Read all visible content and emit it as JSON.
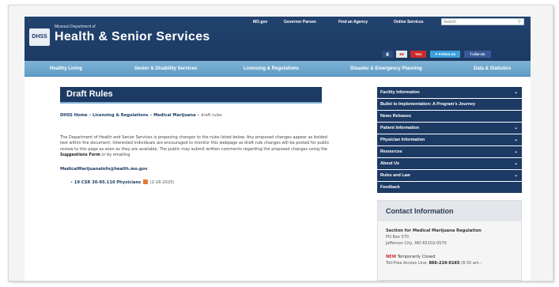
{
  "header": {
    "logo_text": "DHSS",
    "department": "Missouri Department of",
    "agency": "Health & Senior Services",
    "top_links": [
      "MO.gov",
      "Governor Parson",
      "Find an Agency",
      "Online Services"
    ],
    "search_placeholder": "Search",
    "social": [
      "print",
      "share",
      "YouTube",
      "Follow Us",
      "Like Us"
    ]
  },
  "nav": {
    "items": [
      "Healthy Living",
      "Senior & Disability Services",
      "Licensing & Regulations",
      "Disaster & Emergency Planning",
      "Data & Statistics"
    ]
  },
  "main": {
    "title": "Draft Rules",
    "breadcrumb": {
      "home": "DHSS Home",
      "sep1": " » ",
      "section": "Licensing & Regulations",
      "sep2": " » ",
      "sub": "Medical Marijuana",
      "sep3": " » ",
      "current": "draft rules"
    },
    "intro": {
      "text1": "The Department of Health and Senior Services is proposing changes to the rules listed below. Any proposed changes appear as bolded text within the document. Interested individuals are encouraged to monitor this webpage as draft rule changes will be posted for public review to this page as soon as they are available. The public may submit written comments regarding the proposed changes using the ",
      "form_link": "Suggestions Form",
      "text2": " or by emailing"
    },
    "email": "MedicalMarijuanaInfo@health.mo.gov",
    "rule": {
      "bullet": "•",
      "label": "19 CSR 30-95.110 Physicians",
      "date": "(2-18-2020)"
    }
  },
  "sidebar": {
    "items": [
      {
        "label": "Facility Information",
        "chevron": "⌄"
      },
      {
        "label": "Bullet to Implementation: A Program's Journey",
        "chevron": ""
      },
      {
        "label": "News Releases",
        "chevron": ""
      },
      {
        "label": "Patient Information",
        "chevron": "⌄"
      },
      {
        "label": "Physician Information",
        "chevron": "⌄"
      },
      {
        "label": "Resources",
        "chevron": "⌄"
      },
      {
        "label": "About Us",
        "chevron": "⌄"
      },
      {
        "label": "Rules and Law",
        "chevron": "⌄"
      },
      {
        "label": "Feedback",
        "chevron": ""
      }
    ]
  },
  "contact": {
    "heading": "Contact Information",
    "section": "Section for Medical Marijuana Regulation",
    "po_box": "PO Box 570",
    "city": "Jefferson City, MO 65102-0570",
    "status_new": "NEW",
    "status": "Temporarily Closed",
    "phone_label": "Toll-Free Access Line: ",
    "phone": "866-219-0165",
    "hours": " (8:30 am –"
  },
  "colors": {
    "header_navy": "#1c3a64",
    "nav_blue": "#6fa8d0",
    "accent_red": "#d03030"
  }
}
